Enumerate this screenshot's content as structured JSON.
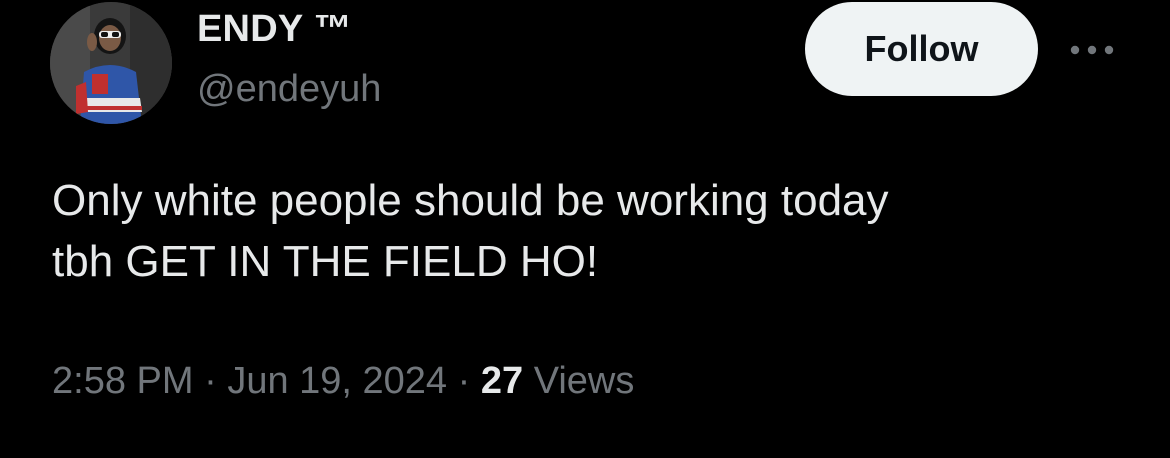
{
  "user": {
    "display_name": "ENDY ™",
    "handle": "@endeyuh",
    "avatar_icon": "profile-photo"
  },
  "actions": {
    "follow_label": "Follow",
    "more_icon": "more-horizontal-icon"
  },
  "tweet": {
    "text_lines": [
      "Only white people should be working today",
      "tbh GET IN THE FIELD HO!"
    ],
    "time": "2:58 PM",
    "separator": "·",
    "date": "Jun 19, 2024",
    "views_count": "27",
    "views_label": "Views"
  },
  "colors": {
    "background": "#000000",
    "primary_text": "#e7e9ea",
    "secondary_text": "#71767b",
    "follow_button_bg": "#eff3f4",
    "follow_button_text": "#0f1419"
  }
}
